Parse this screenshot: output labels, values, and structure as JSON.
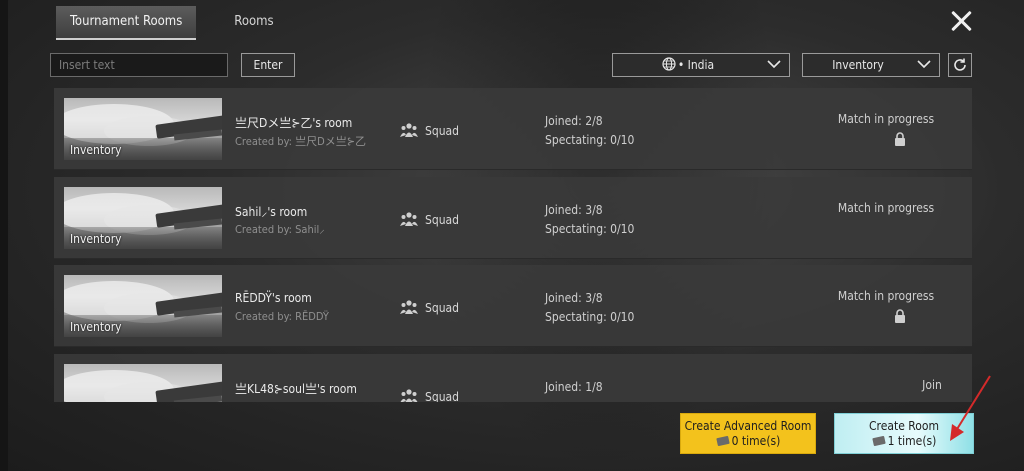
{
  "tabs": [
    {
      "label": "Tournament Rooms",
      "active": true
    },
    {
      "label": "Rooms",
      "active": false
    }
  ],
  "toolbar": {
    "search_placeholder": "Insert text",
    "enter_label": "Enter",
    "region_label": "• India",
    "filter_label": "Inventory"
  },
  "rooms": [
    {
      "thumb_label": "Inventory",
      "name": "亗尺Dメ亗⊱乙's room",
      "creator_prefix": "Created by:",
      "creator": "亗尺Dメ亗⊱乙",
      "team": "Squad",
      "joined": "Joined: 2/8",
      "spectating": "Spectating: 0/10",
      "status": "Match in progress",
      "locked": true
    },
    {
      "thumb_label": "Inventory",
      "name": "Sahil⸝'s room",
      "creator_prefix": "Created by:",
      "creator": "Sahil⸝",
      "team": "Squad",
      "joined": "Joined: 3/8",
      "spectating": "Spectating: 0/10",
      "status": "Match in progress",
      "locked": false
    },
    {
      "thumb_label": "Inventory",
      "name": "RĒDDŸ's room",
      "creator_prefix": "Created by:",
      "creator": "RĒDDŸ",
      "team": "Squad",
      "joined": "Joined: 3/8",
      "spectating": "Spectating: 0/10",
      "status": "Match in progress",
      "locked": true
    },
    {
      "thumb_label": "",
      "name": "亗KL48⊱soul亗's room",
      "creator_prefix": "",
      "creator": "",
      "team": "Squad",
      "joined": "Joined: 1/8",
      "spectating": "",
      "status": "Join",
      "locked": false
    }
  ],
  "buttons": {
    "advanced_title": "Create Advanced Room",
    "advanced_count": "0 time(s)",
    "create_title": "Create Room",
    "create_count": "1 time(s)"
  },
  "colors": {
    "advanced_button": "#f3c21c",
    "create_button": "#bfeef2",
    "annotation_arrow": "#d42a2a"
  },
  "icons": [
    "close-icon",
    "globe-icon",
    "chevron-down-icon",
    "refresh-icon",
    "team-icon",
    "lock-icon",
    "card-icon"
  ]
}
